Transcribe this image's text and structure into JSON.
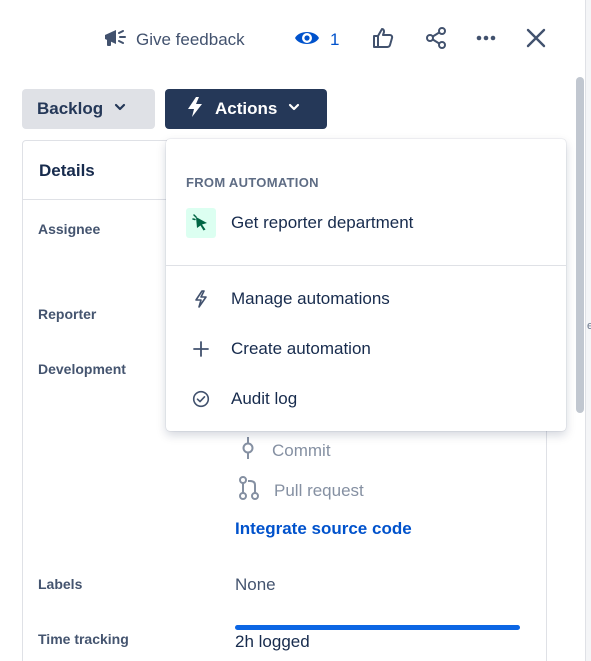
{
  "header": {
    "feedback_label": "Give feedback",
    "feedback_icon": "megaphone-icon",
    "watchers_count": "1",
    "watch_icon": "eye-icon",
    "like_icon": "thumbs-up-icon",
    "share_icon": "share-icon",
    "more_icon": "more-icon",
    "close_icon": "close-icon"
  },
  "toolbar": {
    "status_label": "Backlog",
    "actions_label": "Actions"
  },
  "details": {
    "title": "Details",
    "fields": {
      "assignee": "Assignee",
      "reporter": "Reporter",
      "development": "Development",
      "labels": "Labels",
      "time_tracking": "Time tracking"
    },
    "development": {
      "commit": "Commit",
      "pull_request": "Pull request",
      "integrate_link": "Integrate source code"
    },
    "labels_value": "None",
    "time_tracking": {
      "logged": "2h logged",
      "progress_fraction": 1.0
    }
  },
  "actions_menu": {
    "section_title": "FROM AUTOMATION",
    "automation_item": "Get reporter department",
    "items": [
      {
        "label": "Manage automations",
        "icon": "lightning-icon"
      },
      {
        "label": "Create automation",
        "icon": "plus-icon"
      },
      {
        "label": "Audit log",
        "icon": "check-circle-icon"
      }
    ]
  },
  "colors": {
    "accent": "#0052cc",
    "dark_button": "#253858",
    "automation_icon_bg": "#dcfff1",
    "progress": "#0c66e4"
  }
}
